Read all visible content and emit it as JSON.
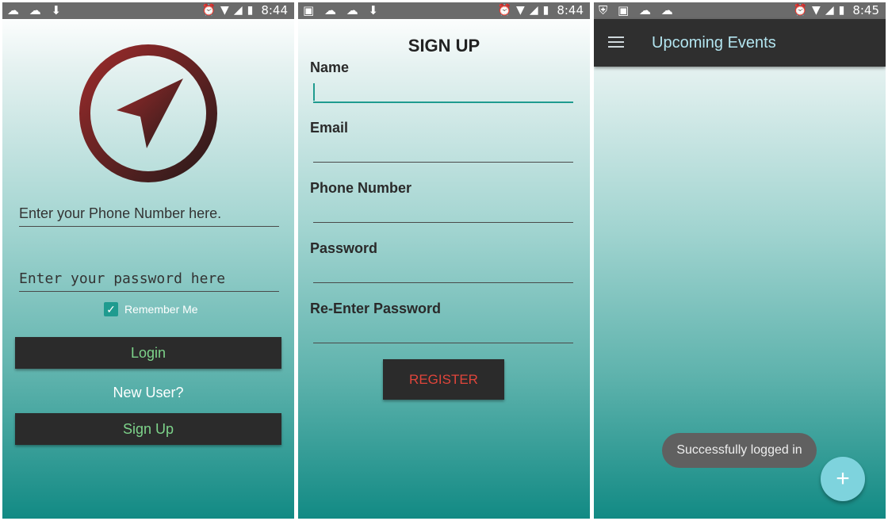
{
  "screen1": {
    "status": {
      "left_icons": "☁ ☁ ⬇",
      "time": "8:44"
    },
    "phone_placeholder": "Enter your Phone Number here.",
    "password_placeholder": "Enter your password here",
    "remember_label": "Remember Me",
    "login_label": "Login",
    "new_user_text": "New User?",
    "signup_label": "Sign Up"
  },
  "screen2": {
    "status": {
      "left_icons": "▣ ☁ ☁ ⬇",
      "time": "8:44"
    },
    "title": "SIGN UP",
    "fields": [
      "Name",
      "Email",
      "Phone Number",
      "Password",
      "Re-Enter Password"
    ],
    "register_label": "REGISTER"
  },
  "screen3": {
    "status": {
      "left_icons": "⛨ ▣ ☁ ☁",
      "time": "8:45"
    },
    "appbar_title": "Upcoming Events",
    "toast_text": "Successfully logged in",
    "fab_label": "+"
  },
  "colors": {
    "accent": "#1f9b8f",
    "button_dark": "#2b2b2b",
    "button_text": "#7dd38a",
    "register_text": "#e0453b"
  }
}
